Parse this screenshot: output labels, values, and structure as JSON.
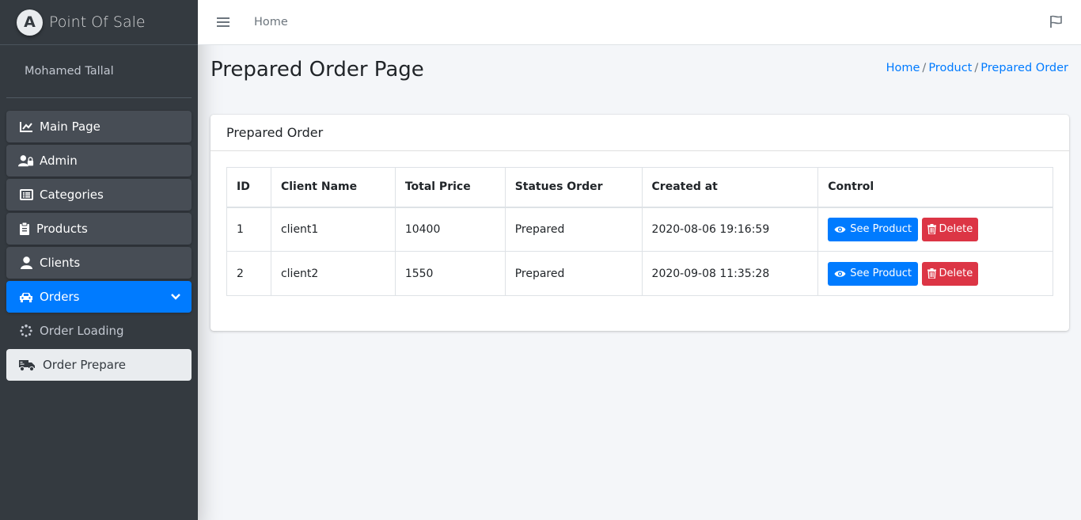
{
  "app": {
    "title": "Point Of Sale",
    "logo_letter": "A"
  },
  "user": {
    "name": "Mohamed Tallal"
  },
  "sidebar": {
    "items": [
      {
        "label": "Main Page",
        "icon": "chart-line-icon"
      },
      {
        "label": "Admin",
        "icon": "user-lock-icon"
      },
      {
        "label": "Categories",
        "icon": "list-alt-icon"
      },
      {
        "label": "Products",
        "icon": "clipboard-icon"
      },
      {
        "label": "Clients",
        "icon": "user-icon"
      },
      {
        "label": "Orders",
        "icon": "car-icon",
        "active": true
      }
    ],
    "subitems": [
      {
        "label": "Order Loading",
        "icon": "spinner-icon"
      },
      {
        "label": "Order Prepare",
        "icon": "truck-icon",
        "current": true
      }
    ]
  },
  "topbar": {
    "home_link": "Home",
    "menu_icon": "bars-icon",
    "flag_icon": "flag-icon"
  },
  "page": {
    "title": "Prepared Order Page",
    "breadcrumb": [
      "Home",
      "Product",
      "Prepared Order"
    ]
  },
  "card": {
    "title": "Prepared Order"
  },
  "table": {
    "headers": [
      "ID",
      "Client Name",
      "Total Price",
      "Statues Order",
      "Created at",
      "Control"
    ],
    "rows": [
      {
        "id": "1",
        "client": "client1",
        "total": "10400",
        "status": "Prepared",
        "created": "2020-08-06 19:16:59"
      },
      {
        "id": "2",
        "client": "client2",
        "total": "1550",
        "status": "Prepared",
        "created": "2020-09-08 11:35:28"
      }
    ],
    "see_label": "See Product",
    "delete_label": "Delete"
  },
  "colors": {
    "primary": "#007bff",
    "danger": "#dc3545",
    "sidebar": "#343a40"
  }
}
